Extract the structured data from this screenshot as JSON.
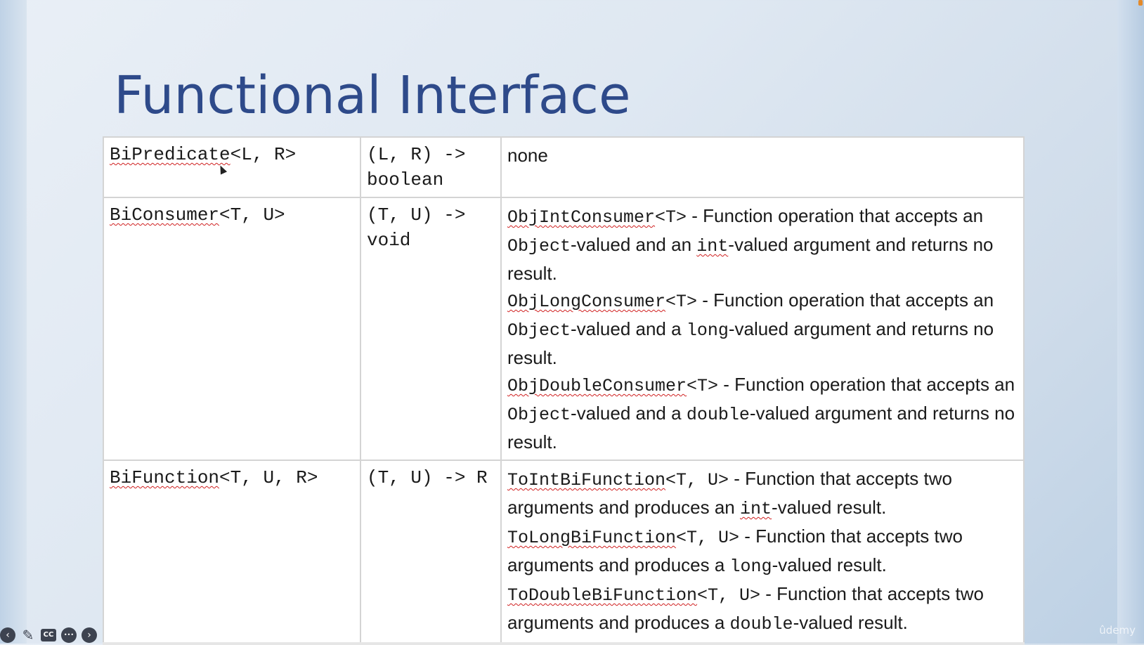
{
  "slide": {
    "title": "Functional Interface",
    "rows": [
      {
        "interface": "BiPredicate<L, R>",
        "signature": "(L, R) -> boolean",
        "specializations": [
          {
            "type_name": "none",
            "type_params": "",
            "description": ""
          }
        ]
      },
      {
        "interface": "BiConsumer<T, U>",
        "signature": "(T, U) -> void",
        "specializations": [
          {
            "type_name": "ObjIntConsumer",
            "type_params": "<T>",
            "description": " - Function operation that accepts an Object-valued and an int-valued argument and returns no result."
          },
          {
            "type_name": "ObjLongConsumer",
            "type_params": "<T>",
            "description": " - Function operation that accepts an Object-valued and a long-valued argument and returns no result."
          },
          {
            "type_name": "ObjDoubleConsumer",
            "type_params": "<T>",
            "description": " - Function operation that accepts an Object-valued and a double-valued argument and returns no result."
          }
        ]
      },
      {
        "interface": "BiFunction<T, U, R>",
        "signature": "(T, U) -> R",
        "specializations": [
          {
            "type_name": "ToIntBiFunction",
            "type_params": "<T, U>",
            "description": " - Function that accepts two arguments and produces an int-valued result."
          },
          {
            "type_name": "ToLongBiFunction",
            "type_params": "<T, U>",
            "description": " - Function that accepts two arguments and produces a long-valued result."
          },
          {
            "type_name": "ToDoubleBiFunction",
            "type_params": "<T, U>",
            "description": " - Function that accepts two arguments and produces a double-valued result."
          }
        ]
      }
    ]
  },
  "player": {
    "controls": [
      {
        "name": "previous-icon",
        "glyph": "‹"
      },
      {
        "name": "pen-icon",
        "glyph": "✎"
      },
      {
        "name": "captions-icon",
        "glyph": "CC"
      },
      {
        "name": "more-icon",
        "glyph": "•••"
      },
      {
        "name": "next-icon",
        "glyph": "›"
      }
    ],
    "brand": "ûdemy"
  },
  "colors": {
    "title": "#2e4a8a",
    "squiggle": "#d02020"
  }
}
